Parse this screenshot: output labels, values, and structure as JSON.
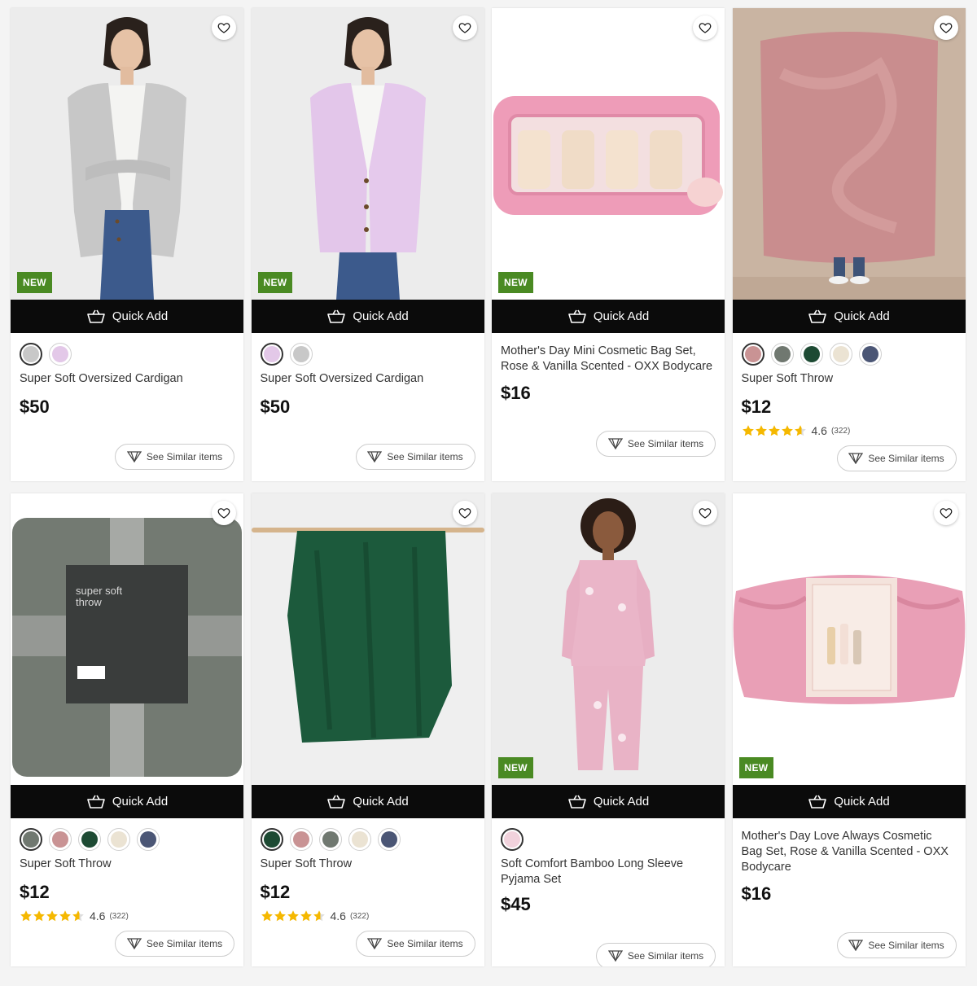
{
  "common": {
    "quick_add": "Quick Add",
    "see_similar": "See Similar items",
    "new_badge": "NEW"
  },
  "colors": {
    "badge": "#4a8a23",
    "quick_add_bg": "#0b0b0b",
    "star": "#f5b800"
  },
  "products": [
    {
      "title": "Super Soft Oversized Cardigan",
      "price": "$50",
      "is_new": true,
      "image": "grey-cardigan-model",
      "swatches": [
        "grey cardigan",
        "lilac cardigan"
      ],
      "rating": null
    },
    {
      "title": "Super Soft Oversized Cardigan",
      "price": "$50",
      "is_new": true,
      "image": "lilac-cardigan-model",
      "swatches": [
        "lilac cardigan",
        "grey cardigan"
      ],
      "rating": null
    },
    {
      "title": "Mother's Day Mini Cosmetic Bag Set, Rose & Vanilla Scented - OXX Bodycare",
      "price": "$16",
      "is_new": true,
      "image": "pink-cosmetic-bag",
      "swatches": [],
      "rating": null
    },
    {
      "title": "Super Soft Throw",
      "price": "$12",
      "is_new": false,
      "image": "pink-throw",
      "swatches": [
        "pink",
        "grey",
        "green",
        "cream",
        "navy"
      ],
      "rating": {
        "value": "4.6",
        "count": "(322)",
        "stars": 4.6
      }
    },
    {
      "title": "Super Soft Throw",
      "price": "$12",
      "is_new": false,
      "image": "grey-throw-packaged",
      "swatches": [
        "grey",
        "pink",
        "green",
        "cream",
        "navy"
      ],
      "rating": {
        "value": "4.6",
        "count": "(322)",
        "stars": 4.6
      }
    },
    {
      "title": "Super Soft Throw",
      "price": "$12",
      "is_new": false,
      "image": "green-throw",
      "swatches": [
        "green",
        "pink",
        "grey",
        "cream",
        "navy"
      ],
      "rating": {
        "value": "4.6",
        "count": "(322)",
        "stars": 4.6
      }
    },
    {
      "title": "Soft Comfort Bamboo Long Sleeve Pyjama Set",
      "price": "$45",
      "is_new": true,
      "image": "floral-pyjama-model",
      "swatches": [
        "pink floral"
      ],
      "rating": null
    },
    {
      "title": "Mother's Day Love Always Cosmetic Bag Set, Rose & Vanilla Scented - OXX Bodycare",
      "price": "$16",
      "is_new": true,
      "image": "love-always-cosmetic-bag",
      "swatches": [],
      "rating": null
    }
  ]
}
